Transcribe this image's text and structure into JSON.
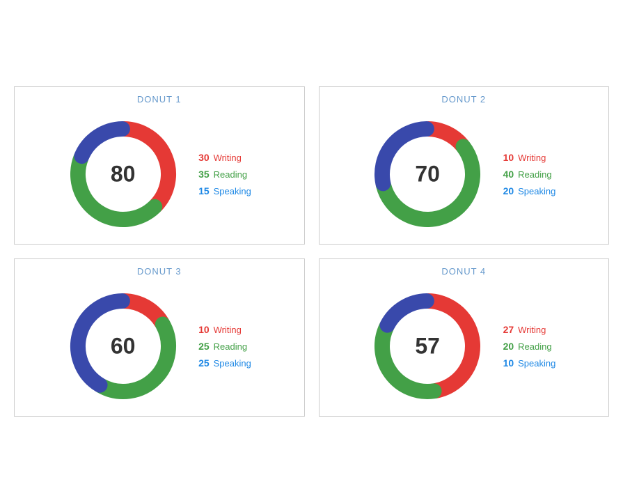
{
  "donuts": [
    {
      "id": "donut1",
      "title": "DONUT 1",
      "center": "80",
      "segments": [
        {
          "label": "Writing",
          "value": 30,
          "color": "#e53935"
        },
        {
          "label": "Reading",
          "value": 35,
          "color": "#43a047"
        },
        {
          "label": "Speaking",
          "value": 15,
          "color": "#3949ab"
        }
      ]
    },
    {
      "id": "donut2",
      "title": "DONUT 2",
      "center": "70",
      "segments": [
        {
          "label": "Writing",
          "value": 10,
          "color": "#e53935"
        },
        {
          "label": "Reading",
          "value": 40,
          "color": "#43a047"
        },
        {
          "label": "Speaking",
          "value": 20,
          "color": "#3949ab"
        }
      ]
    },
    {
      "id": "donut3",
      "title": "DONUT 3",
      "center": "60",
      "segments": [
        {
          "label": "Writing",
          "value": 10,
          "color": "#e53935"
        },
        {
          "label": "Reading",
          "value": 25,
          "color": "#43a047"
        },
        {
          "label": "Speaking",
          "value": 25,
          "color": "#3949ab"
        }
      ]
    },
    {
      "id": "donut4",
      "title": "DONUT 4",
      "center": "57",
      "segments": [
        {
          "label": "Writing",
          "value": 27,
          "color": "#e53935"
        },
        {
          "label": "Reading",
          "value": 20,
          "color": "#43a047"
        },
        {
          "label": "Speaking",
          "value": 10,
          "color": "#3949ab"
        }
      ]
    }
  ],
  "colors": {
    "writing": "#e53935",
    "reading": "#43a047",
    "speaking": "#3949ab"
  }
}
